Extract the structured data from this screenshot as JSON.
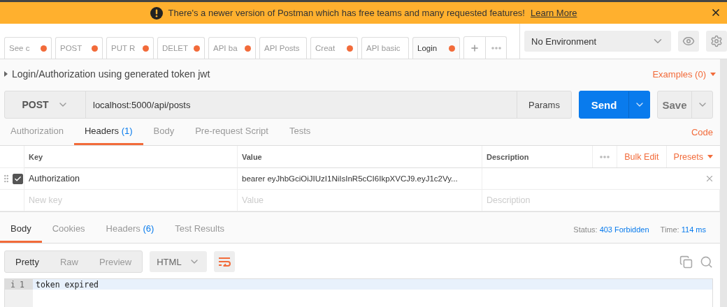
{
  "banner": {
    "text": "There's a newer version of Postman which has free teams and many requested features!",
    "link": "Learn More"
  },
  "tabs": [
    {
      "label": "See c",
      "unsaved": true,
      "selected": false
    },
    {
      "label": "POST",
      "unsaved": true,
      "selected": false
    },
    {
      "label": "PUT R",
      "unsaved": true,
      "selected": false
    },
    {
      "label": "DELET",
      "unsaved": true,
      "selected": false
    },
    {
      "label": "API ba",
      "unsaved": true,
      "selected": false
    },
    {
      "label": "API Posts",
      "unsaved": false,
      "selected": false
    },
    {
      "label": "Creat",
      "unsaved": true,
      "selected": false
    },
    {
      "label": "API basic",
      "unsaved": false,
      "selected": false
    },
    {
      "label": "Login",
      "unsaved": true,
      "selected": true
    }
  ],
  "environment": {
    "value": "No Environment"
  },
  "request": {
    "title": "Login/Authorization using generated token jwt",
    "examples": "Examples (0)",
    "method": "POST",
    "url": "localhost:5000/api/posts",
    "params": "Params",
    "send": "Send",
    "save": "Save"
  },
  "request_tabs": [
    {
      "label": "Authorization",
      "selected": false
    },
    {
      "label": "Headers",
      "count": "(1)",
      "selected": true
    },
    {
      "label": "Body",
      "selected": false
    },
    {
      "label": "Pre-request Script",
      "selected": false
    },
    {
      "label": "Tests",
      "selected": false
    }
  ],
  "code_link": "Code",
  "headers_table": {
    "columns": [
      "Key",
      "Value",
      "Description"
    ],
    "bulk_edit": "Bulk Edit",
    "presets": "Presets",
    "rows": [
      {
        "key": "Authorization",
        "value": "bearer eyJhbGciOiJIUzI1NiIsInR5cCI6IkpXVCJ9.eyJ1c2Vy...",
        "checked": true
      }
    ],
    "new_row": {
      "key": {
        "placeholder": "New key"
      },
      "value": {
        "placeholder": "Value"
      },
      "description": {
        "placeholder": "Description"
      }
    }
  },
  "response": {
    "tabs": [
      {
        "label": "Body",
        "selected": true
      },
      {
        "label": "Cookies",
        "selected": false
      },
      {
        "label": "Headers",
        "count": "(6)",
        "selected": false
      },
      {
        "label": "Test Results",
        "selected": false
      }
    ],
    "status_label": "Status:",
    "status": "403 Forbidden",
    "time_label": "Time:",
    "time": "114 ms",
    "view_modes": [
      {
        "label": "Pretty",
        "selected": true
      },
      {
        "label": "Raw",
        "selected": false
      },
      {
        "label": "Preview",
        "selected": false
      }
    ],
    "format": "HTML",
    "lines": [
      {
        "marker": "i",
        "number": "1",
        "text": "token expired"
      }
    ]
  }
}
